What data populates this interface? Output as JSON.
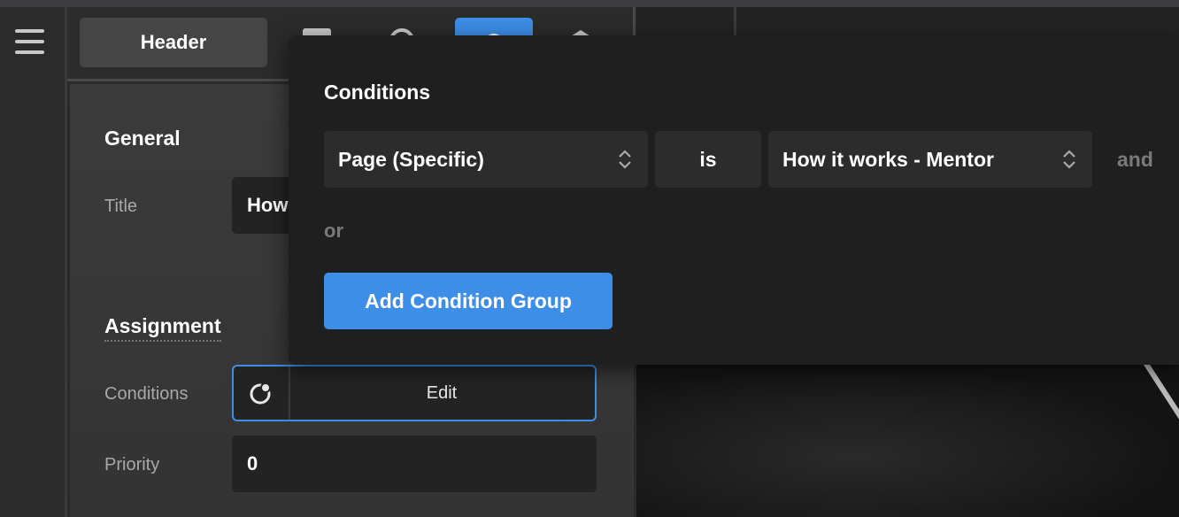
{
  "toolbar": {
    "header_label": "Header",
    "icons": [
      "menu-icon",
      "layout-icon",
      "search-icon",
      "gear-icon",
      "layers-icon"
    ],
    "accent_color": "#3d8ee6"
  },
  "panel": {
    "general_title": "General",
    "title_label": "Title",
    "title_value": "How",
    "assignment_title": "Assignment",
    "conditions_label": "Conditions",
    "conditions_button": "Edit",
    "priority_label": "Priority",
    "priority_value": "0"
  },
  "popover": {
    "title": "Conditions",
    "condition": {
      "field": "Page (Specific)",
      "operator": "is",
      "value": "How it works - Mentor"
    },
    "and_label": "and",
    "or_label": "or",
    "add_group_button": "Add Condition Group"
  }
}
